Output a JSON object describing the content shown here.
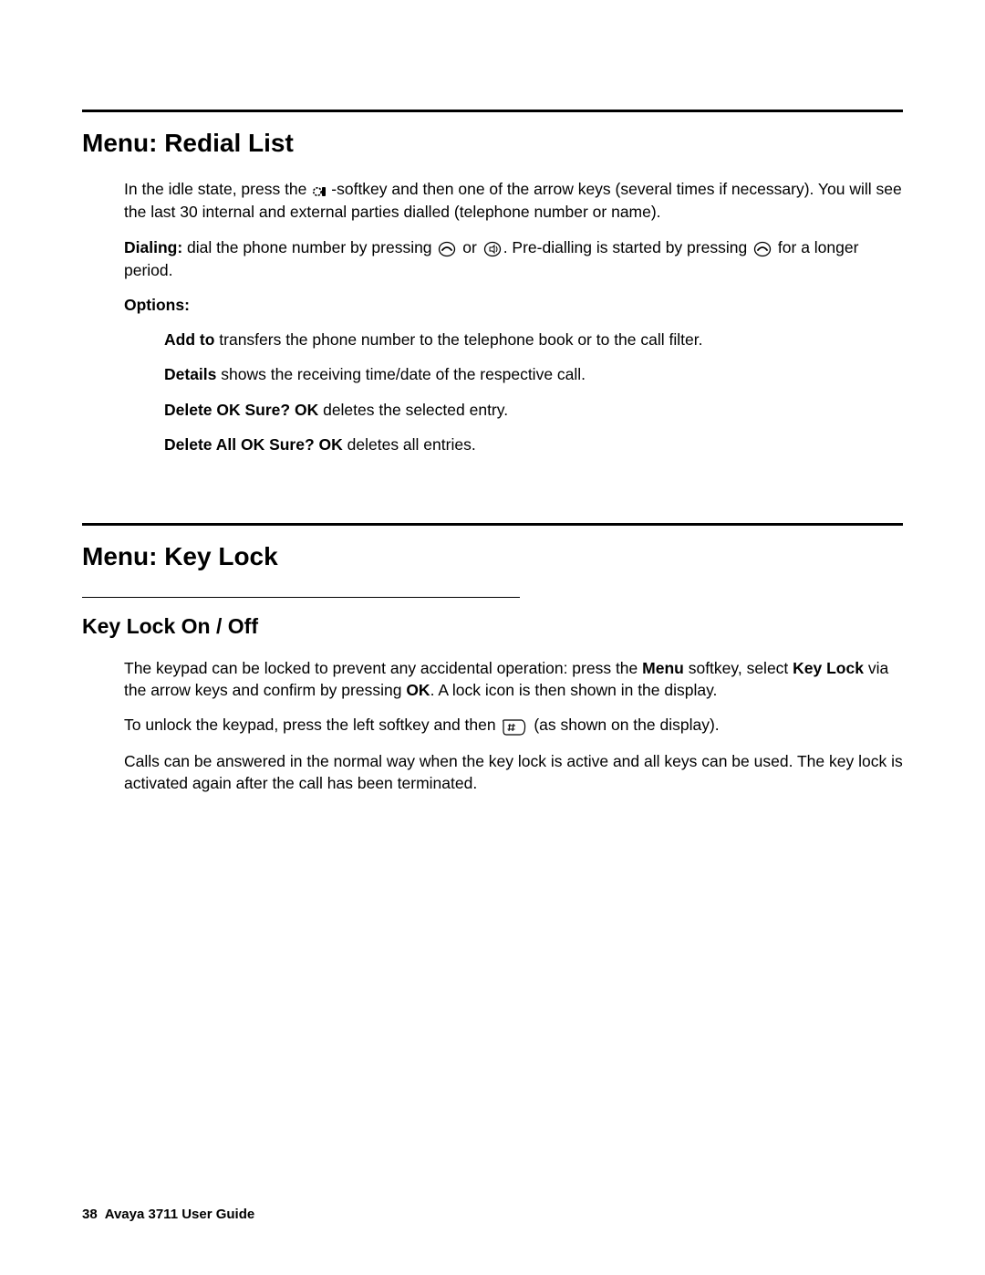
{
  "section1": {
    "heading": "Menu: Redial List",
    "intro_before_icon": "In the idle state, press the ",
    "intro_after_icon": "-softkey and then one of the arrow keys (several times if necessary). You will see the last 30 internal and external parties dialled (telephone number or name).",
    "dialing_label": "Dialing:",
    "dialing_text1": " dial the phone number by pressing ",
    "dialing_text2": " or ",
    "dialing_text3": ". Pre-dialling is started by pressing ",
    "dialing_text4": " for a longer period.",
    "options_label": "Options:",
    "options": [
      {
        "bold": "Add to",
        "text": " transfers the phone number to the telephone book or to the call filter."
      },
      {
        "bold": "Details",
        "text": " shows the receiving time/date of the respective call."
      },
      {
        "bold": "Delete OK Sure? OK",
        "text": " deletes the selected entry."
      },
      {
        "bold": "Delete All OK Sure? OK",
        "text": " deletes all entries."
      }
    ]
  },
  "section2": {
    "heading": "Menu: Key Lock",
    "subheading": "Key Lock On / Off",
    "p1_a": "The keypad can be locked to prevent any accidental operation: press the ",
    "p1_menu": "Menu",
    "p1_b": " softkey, select ",
    "p1_keylock": "Key Lock",
    "p1_c": " via the arrow keys and confirm by pressing ",
    "p1_ok": "OK",
    "p1_d": ". A lock icon is then shown in the display.",
    "p2_a": "To unlock the keypad, press the left softkey and then ",
    "p2_b": " (as shown on the display).",
    "p3": "Calls can be answered in the normal way when the key lock is active and all keys can be used. The key lock is activated again after the call has been terminated."
  },
  "footer": {
    "page": "38",
    "title": "Avaya 3711 User Guide"
  }
}
